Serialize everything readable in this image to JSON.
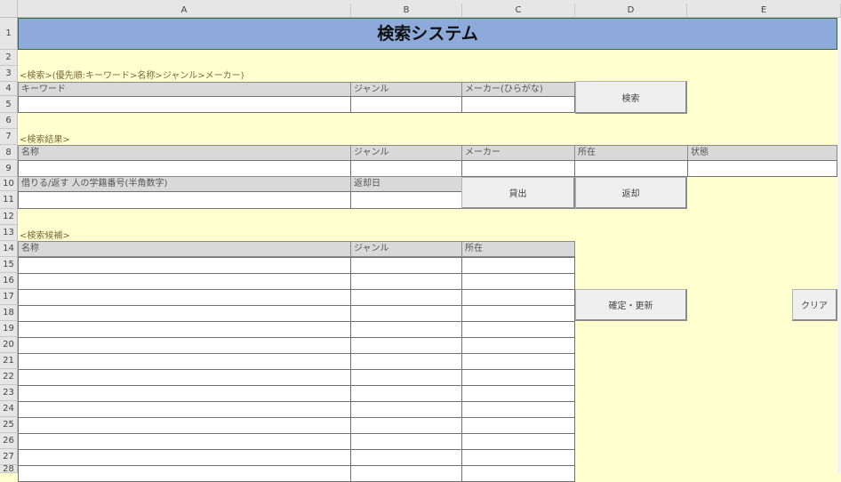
{
  "columns": [
    "A",
    "B",
    "C",
    "D",
    "E"
  ],
  "rows": [
    "1",
    "2",
    "3",
    "4",
    "5",
    "6",
    "7",
    "8",
    "9",
    "10",
    "11",
    "12",
    "13",
    "14",
    "15",
    "16",
    "17",
    "18",
    "19",
    "20",
    "21",
    "22",
    "23",
    "24",
    "25",
    "26",
    "27",
    "28"
  ],
  "title": "検索システム",
  "search": {
    "section_label": "<検索>(優先順:キーワード>名称>ジャンル>メーカー)",
    "keyword_label": "キーワード",
    "genre_label": "ジャンル",
    "maker_label": "メーカー(ひらがな)",
    "search_button": "検索"
  },
  "result": {
    "section_label": "<検索結果>",
    "name_label": "名称",
    "genre_label": "ジャンル",
    "maker_label": "メーカー",
    "location_label": "所在",
    "status_label": "状態",
    "borrower_label": "借りる/返す 人の学籍番号(半角数字)",
    "return_date_label": "返却日",
    "lend_button": "貸出",
    "return_button": "返却"
  },
  "candidates": {
    "section_label": "<検索候補>",
    "name_label": "名称",
    "genre_label": "ジャンル",
    "location_label": "所在",
    "confirm_button": "確定・更新",
    "clear_button": "クリア"
  }
}
